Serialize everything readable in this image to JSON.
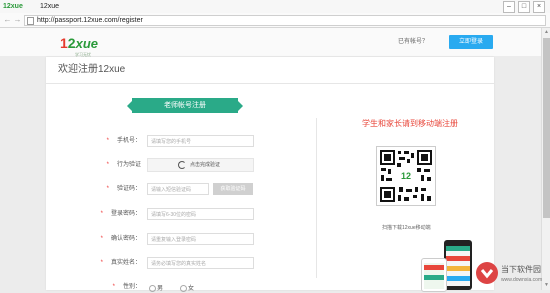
{
  "window": {
    "title": "12xue",
    "icon_label": "12xue"
  },
  "browser": {
    "back_icon": "back-arrow-icon",
    "forward_icon": "forward-arrow-icon",
    "url": "http://passport.12xue.com/register"
  },
  "header": {
    "logo": {
      "one": "1",
      "two": "2",
      "xue": "xue",
      "tagline": "学习无忧"
    },
    "has_account": "已有帐号？",
    "login_button": "立即登录"
  },
  "page": {
    "title": "欢迎注册12xue",
    "ribbon": "老师帐号注册"
  },
  "form": {
    "rows": [
      {
        "label": "手机号：",
        "placeholder": "请填写您的手机号"
      },
      {
        "label": "行为验证",
        "captcha_text": "点击完成验证"
      },
      {
        "label": "验证码：",
        "placeholder": "请输入短信验证码",
        "button": "获取验证码"
      },
      {
        "label": "登录密码：",
        "placeholder": "请填写6-30位的密码"
      },
      {
        "label": "确认密码：",
        "placeholder": "请重复输入登录密码"
      },
      {
        "label": "真实姓名：",
        "placeholder": "请务必填写您的真实姓名"
      },
      {
        "label": "性别：",
        "options": [
          "男",
          "女"
        ]
      }
    ]
  },
  "mobile": {
    "heading": "学生和家长请到移动端注册",
    "qr_caption": "扫描下载12xue移动端"
  },
  "watermark": {
    "name": "当下软件园",
    "url": "www.downxia.com"
  },
  "colors": {
    "accent": "#29aaf0",
    "ribbon": "#2aaa88",
    "mobile_heading": "#e8473b"
  }
}
